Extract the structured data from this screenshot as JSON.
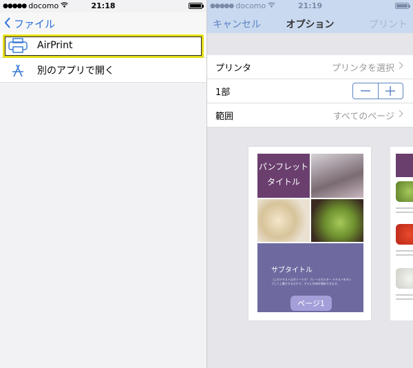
{
  "left": {
    "status": {
      "carrier": "docomo",
      "time": "21:18"
    },
    "nav": {
      "back_label": "ファイル"
    },
    "items": [
      {
        "label": "AirPrint"
      },
      {
        "label": "別のアプリで開く"
      }
    ]
  },
  "right": {
    "status": {
      "carrier": "docomo",
      "time": "21:19"
    },
    "nav": {
      "cancel_label": "キャンセル",
      "title": "オプション",
      "print_label": "プリント"
    },
    "options": {
      "printer": {
        "label": "プリンタ",
        "value": "プリンタを選択"
      },
      "copies": {
        "label": "1部",
        "minus": "—",
        "plus": "+"
      },
      "range": {
        "label": "範囲",
        "value": "すべてのページ"
      }
    },
    "preview": {
      "title_line1": "パンフレット",
      "title_line2": "タイトル",
      "subtitle": "サブタイトル",
      "body_text": "〔このテキストはダミーです〕ブレースホルダー テキストをタップして上書きするだけで、すぐに作成を開始できます。",
      "page_badge": "ページ1"
    }
  },
  "colors": {
    "accent": "#2a6fdb",
    "highlight": "#e5de17",
    "right_header": "#c9d9ef",
    "purple": "#6a3f6e",
    "lavender": "#6e6aa0"
  },
  "icons": {
    "printer": "printer-icon",
    "app": "app-store-icon",
    "wifi": "wifi-icon",
    "battery": "battery-icon"
  }
}
